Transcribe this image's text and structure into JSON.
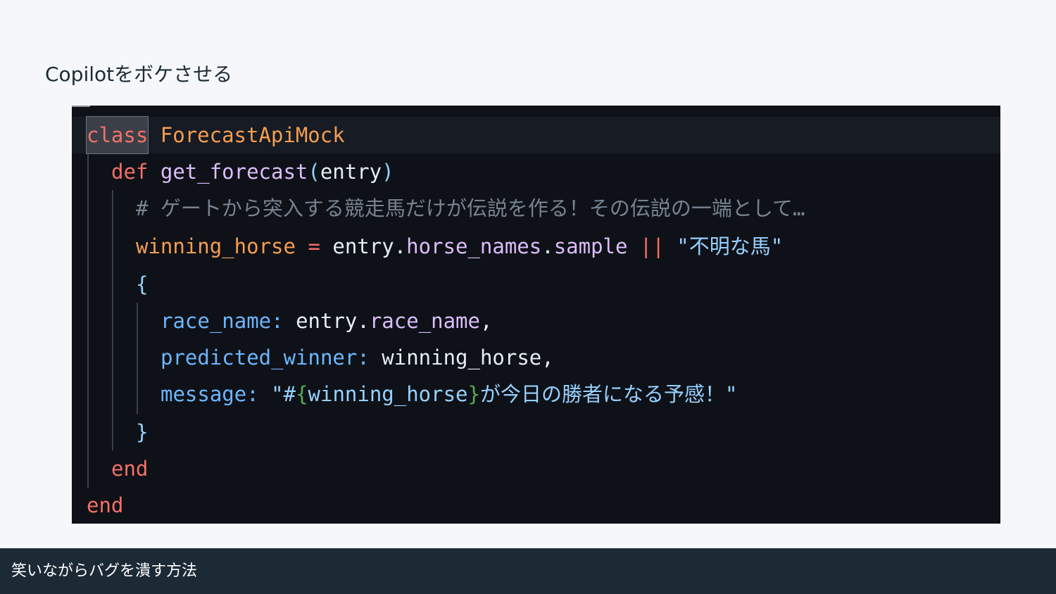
{
  "slide": {
    "title": "Copilotをボケさせる",
    "footer": "笑いながらバグを潰す方法"
  },
  "code": {
    "l1_kw": "class",
    "l1_name": "ForecastApiMock",
    "l2_kw": "def",
    "l2_fn": "get_forecast",
    "l2_open": "(",
    "l2_arg": "entry",
    "l2_close": ")",
    "l3_comment": "# ゲートから突入する競走馬だけが伝説を作る！その伝説の一端として…",
    "l4_var": "winning_horse",
    "l4_eq": " = ",
    "l4_obj": "entry",
    "l4_dot1": ".",
    "l4_m1": "horse_names",
    "l4_dot2": ".",
    "l4_m2": "sample",
    "l4_or": " || ",
    "l4_str": "\"不明な馬\"",
    "l5_brace": "{",
    "l6_key": "race_name:",
    "l6_obj": " entry",
    "l6_dot": ".",
    "l6_prop": "race_name",
    "l6_comma": ",",
    "l7_key": "predicted_winner:",
    "l7_val": " winning_horse,",
    "l8_key": "message:",
    "l8_q1": " \"#",
    "l8_ib1": "{",
    "l8_ivar": "winning_horse",
    "l8_ib2": "}",
    "l8_text": "が今日の勝者になる予感！\"",
    "l9_brace": "}",
    "l10_end": "end",
    "l11_end": "end"
  },
  "colors": {
    "keyword": "#f47067",
    "class_name": "#f69d50",
    "function": "#dcbdfb",
    "string": "#96d0ff",
    "comment": "#768390",
    "hash_key": "#6cb6ff",
    "interpolation": "#57ab5a",
    "panel_bg": "#0e1117",
    "footer_bg": "#1c2a36"
  }
}
